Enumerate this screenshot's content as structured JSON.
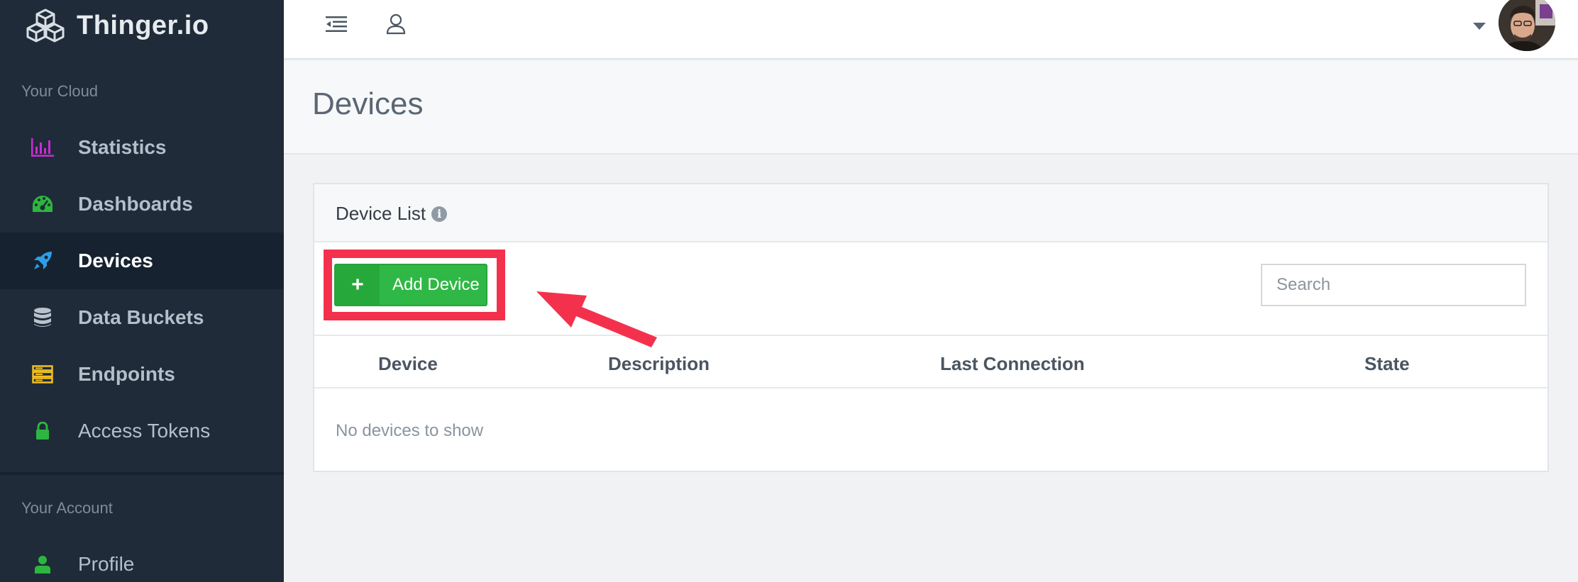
{
  "brand": {
    "name": "Thinger.io",
    "icon": "cubes-logo-icon"
  },
  "sidebar": {
    "section_cloud": "Your Cloud",
    "items": [
      {
        "label": "Statistics",
        "icon": "bar-chart-icon",
        "color": "#cc2bd6"
      },
      {
        "label": "Dashboards",
        "icon": "dashboard-gauge-icon",
        "color": "#2cb63f"
      },
      {
        "label": "Devices",
        "icon": "rocket-icon",
        "color": "#2e9ee6",
        "active": true
      },
      {
        "label": "Data Buckets",
        "icon": "database-icon",
        "color": "#b9c3cd"
      },
      {
        "label": "Endpoints",
        "icon": "server-icon",
        "color": "#f2c026"
      },
      {
        "label": "Access Tokens",
        "icon": "lock-icon",
        "color": "#2cb63f"
      }
    ],
    "section_account": "Your Account",
    "account_items": [
      {
        "label": "Profile",
        "icon": "user-icon",
        "color": "#2cb63f"
      }
    ]
  },
  "topbar": {
    "menu_icon": "indent-menu-icon",
    "user_icon": "user-outline-icon"
  },
  "page": {
    "title": "Devices"
  },
  "panel": {
    "title": "Device List",
    "add_button": "Add Device",
    "search_placeholder": "Search",
    "columns": [
      "Device",
      "Description",
      "Last Connection",
      "State"
    ],
    "empty_text": "No devices to show"
  },
  "colors": {
    "accent_green": "#2fb845",
    "highlight_red": "#f4314d",
    "sidebar_bg": "#1f2b38"
  }
}
